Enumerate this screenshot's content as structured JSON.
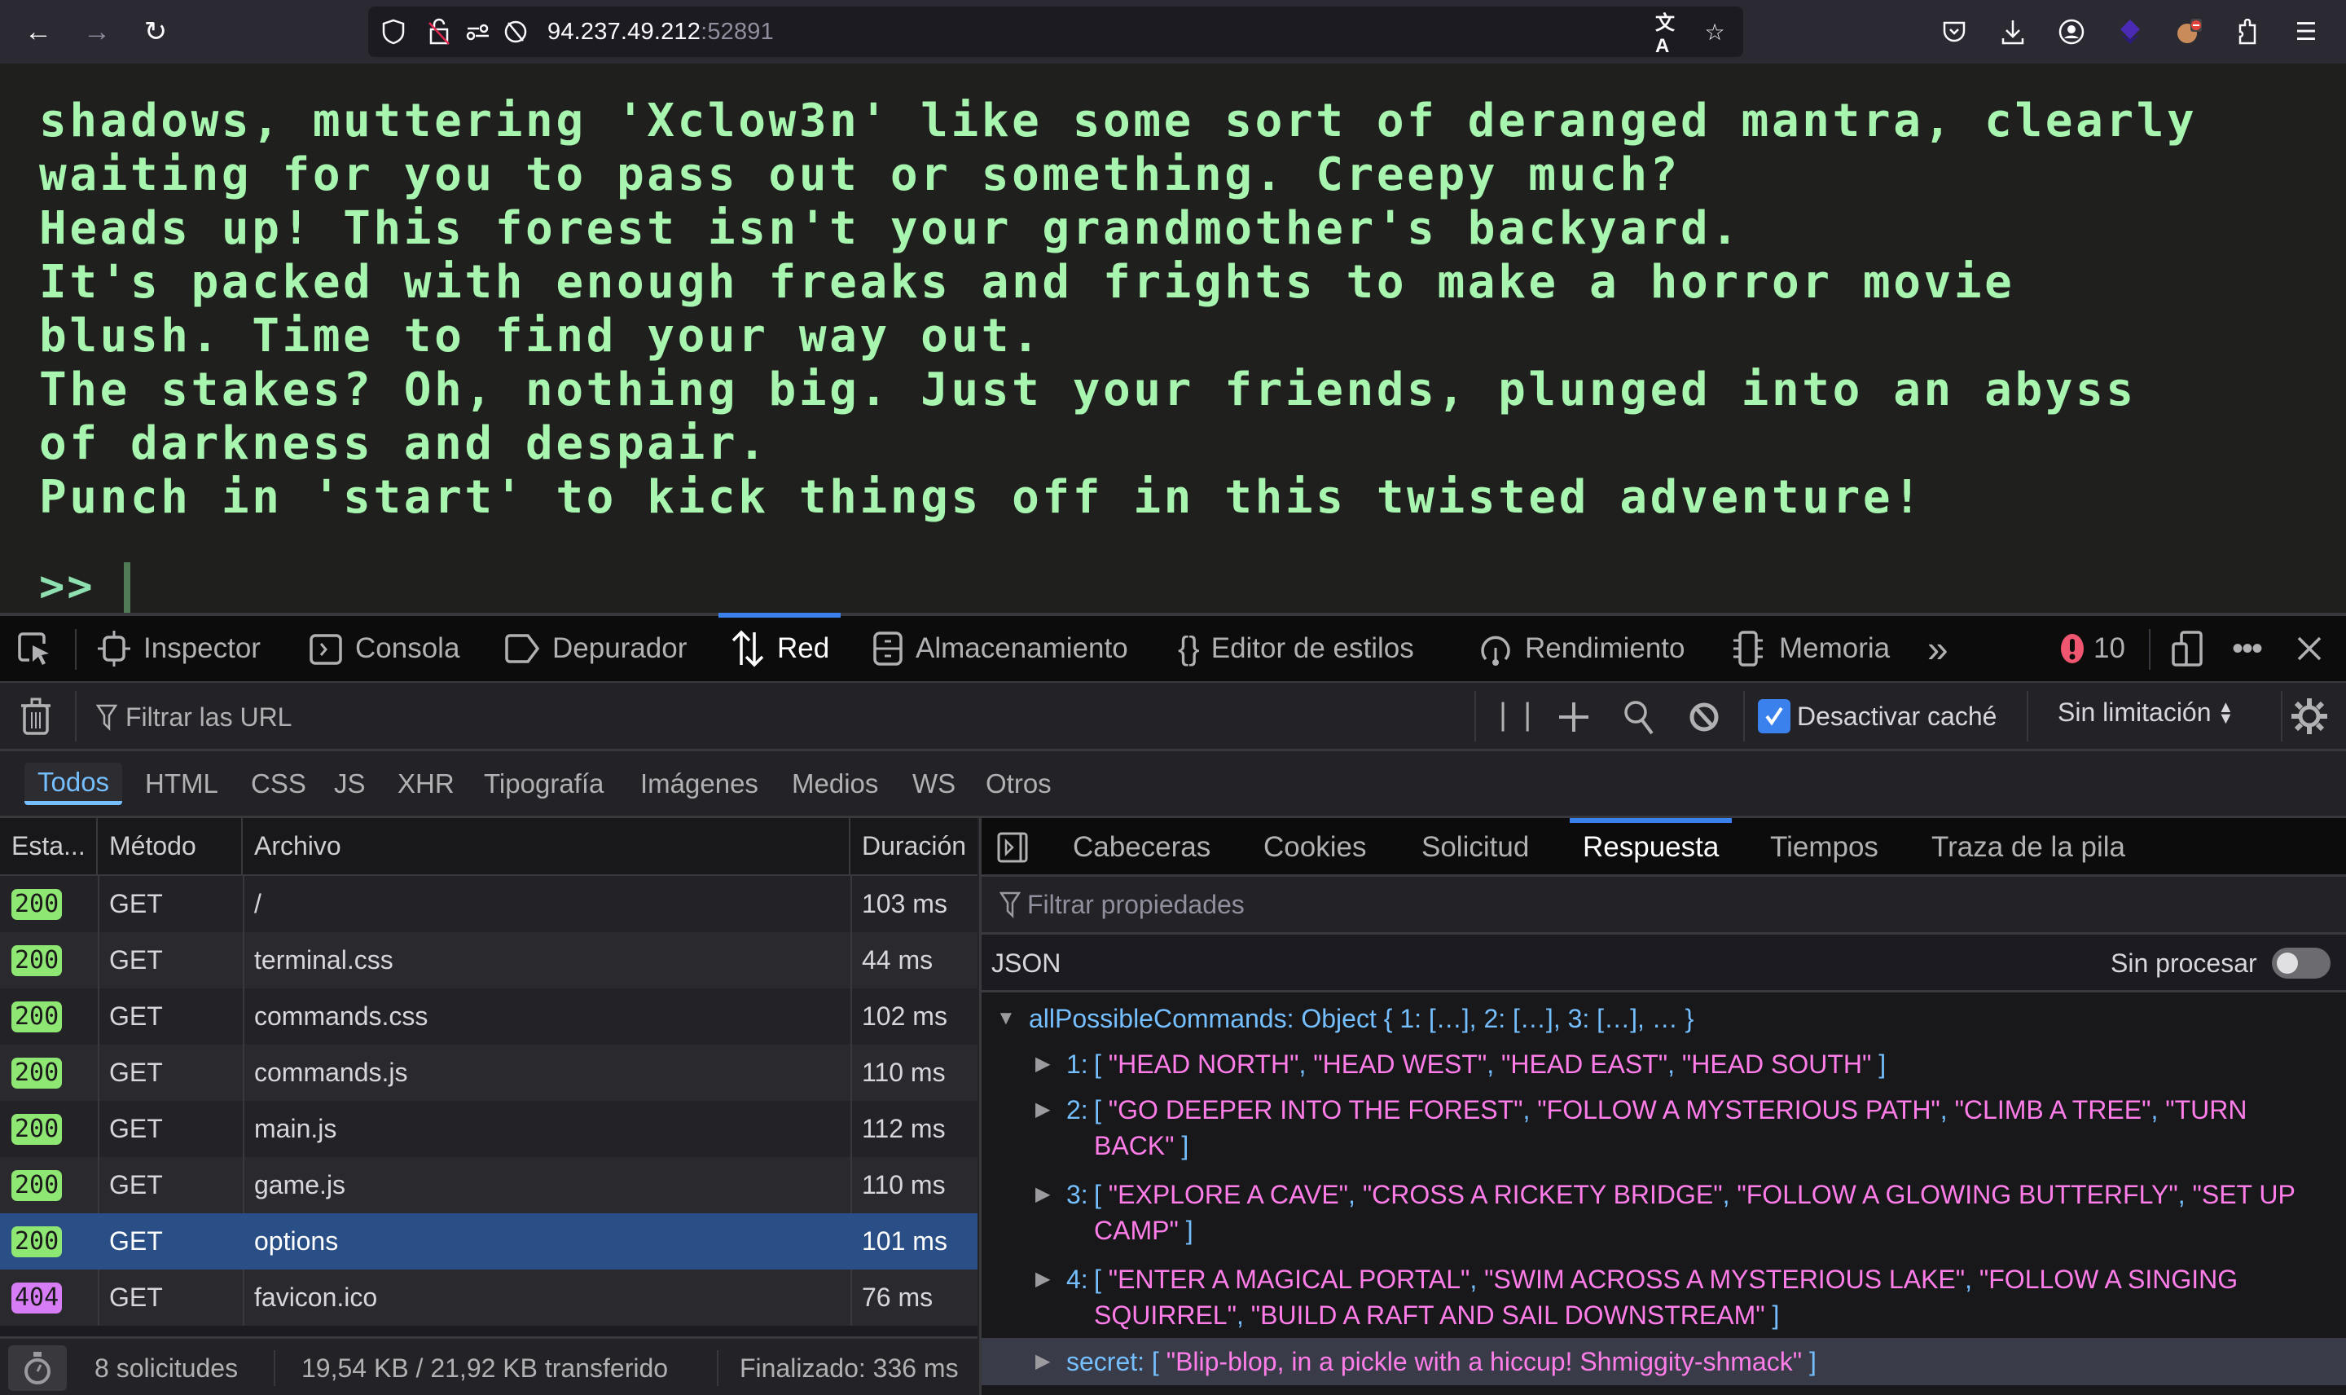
{
  "browser": {
    "url_host": "94.237.49.212",
    "url_port": ":52891",
    "icons": {
      "back": "←",
      "forward": "→",
      "reload": "↻",
      "shield": "⛉",
      "insecure_lock": "🔓",
      "permissions": "⚙",
      "tracking": "⊘",
      "translate": "文A",
      "bookmark": "☆",
      "pocket": "⛉",
      "downloads": "⭳",
      "account": "◉",
      "extension_purple": "◆",
      "extension_fox": "🦊",
      "extensions": "🧩",
      "menu": "☰"
    }
  },
  "terminal": {
    "lines": [
      "shadows, muttering 'Xclow3n' like some sort of deranged mantra, clearly",
      "waiting for you to pass out or something. Creepy much?",
      "Heads up! This forest isn't your grandmother's backyard.",
      "It's packed with enough freaks and frights to make a horror movie",
      "blush. Time to find your way out.",
      "The stakes? Oh, nothing big. Just your friends, plunged into an abyss",
      "of darkness and despair.",
      "Punch in 'start' to kick things off in this twisted adventure!"
    ],
    "prompt": ">>",
    "input_value": ""
  },
  "devtools": {
    "tabs": [
      {
        "label": "Inspector",
        "icon": "⌖"
      },
      {
        "label": "Consola",
        "icon": "⊡"
      },
      {
        "label": "Depurador",
        "icon": "▷"
      },
      {
        "label": "Red",
        "icon": "⇅",
        "active": true
      },
      {
        "label": "Almacenamiento",
        "icon": "▤"
      },
      {
        "label": "Editor de estilos",
        "icon": "{}"
      },
      {
        "label": "Rendimiento",
        "icon": "◔"
      },
      {
        "label": "Memoria",
        "icon": "▯"
      }
    ],
    "more_tabs": "»",
    "error_count": "10",
    "filter_placeholder": "Filtrar las URL",
    "disable_cache_label": "Desactivar caché",
    "disable_cache_checked": true,
    "throttling": "Sin limitación",
    "type_filters": [
      "Todos",
      "HTML",
      "CSS",
      "JS",
      "XHR",
      "Tipografía",
      "Imágenes",
      "Medios",
      "WS",
      "Otros"
    ],
    "active_type_filter": "Todos",
    "columns": [
      "Esta...",
      "Método",
      "Archivo",
      "Duración"
    ],
    "requests": [
      {
        "status": "200",
        "method": "GET",
        "file": "/",
        "duration": "103 ms"
      },
      {
        "status": "200",
        "method": "GET",
        "file": "terminal.css",
        "duration": "44 ms"
      },
      {
        "status": "200",
        "method": "GET",
        "file": "commands.css",
        "duration": "102 ms"
      },
      {
        "status": "200",
        "method": "GET",
        "file": "commands.js",
        "duration": "110 ms"
      },
      {
        "status": "200",
        "method": "GET",
        "file": "main.js",
        "duration": "112 ms"
      },
      {
        "status": "200",
        "method": "GET",
        "file": "game.js",
        "duration": "110 ms"
      },
      {
        "status": "200",
        "method": "GET",
        "file": "options",
        "duration": "101 ms",
        "selected": true
      },
      {
        "status": "404",
        "method": "GET",
        "file": "favicon.ico",
        "duration": "76 ms"
      }
    ],
    "status_colors": {
      "200": "#8ee673",
      "404": "#d67cf5"
    },
    "summary": {
      "requests": "8 solicitudes",
      "transferred": "19,54 KB / 21,92 KB transferido",
      "finished": "Finalizado: 336 ms"
    },
    "detail_tabs": [
      "Cabeceras",
      "Cookies",
      "Solicitud",
      "Respuesta",
      "Tiempos",
      "Traza de la pila"
    ],
    "active_detail_tab": "Respuesta",
    "prop_filter_placeholder": "Filtrar propiedades",
    "json_label": "JSON",
    "raw_label": "Sin procesar",
    "raw_enabled": false,
    "json": {
      "root_key": "allPossibleCommands:",
      "root_preview": "Object { 1: […], 2: […], 3: […], … }",
      "entries": [
        {
          "key": "1:",
          "values": [
            "HEAD NORTH",
            "HEAD WEST",
            "HEAD EAST",
            "HEAD SOUTH"
          ]
        },
        {
          "key": "2:",
          "values": [
            "GO DEEPER INTO THE FOREST",
            "FOLLOW A MYSTERIOUS PATH",
            "CLIMB A TREE",
            "TURN BACK"
          ]
        },
        {
          "key": "3:",
          "values": [
            "EXPLORE A CAVE",
            "CROSS A RICKETY BRIDGE",
            "FOLLOW A GLOWING BUTTERFLY",
            "SET UP CAMP"
          ]
        },
        {
          "key": "4:",
          "values": [
            "ENTER A MAGICAL PORTAL",
            "SWIM ACROSS A MYSTERIOUS LAKE",
            "FOLLOW A SINGING SQUIRREL",
            "BUILD A RAFT AND SAIL DOWNSTREAM"
          ]
        }
      ],
      "secret_key": "secret:",
      "secret_values": [
        "Blip-blop, in a pickle with a hiccup! Shmiggity-shmack"
      ]
    }
  }
}
